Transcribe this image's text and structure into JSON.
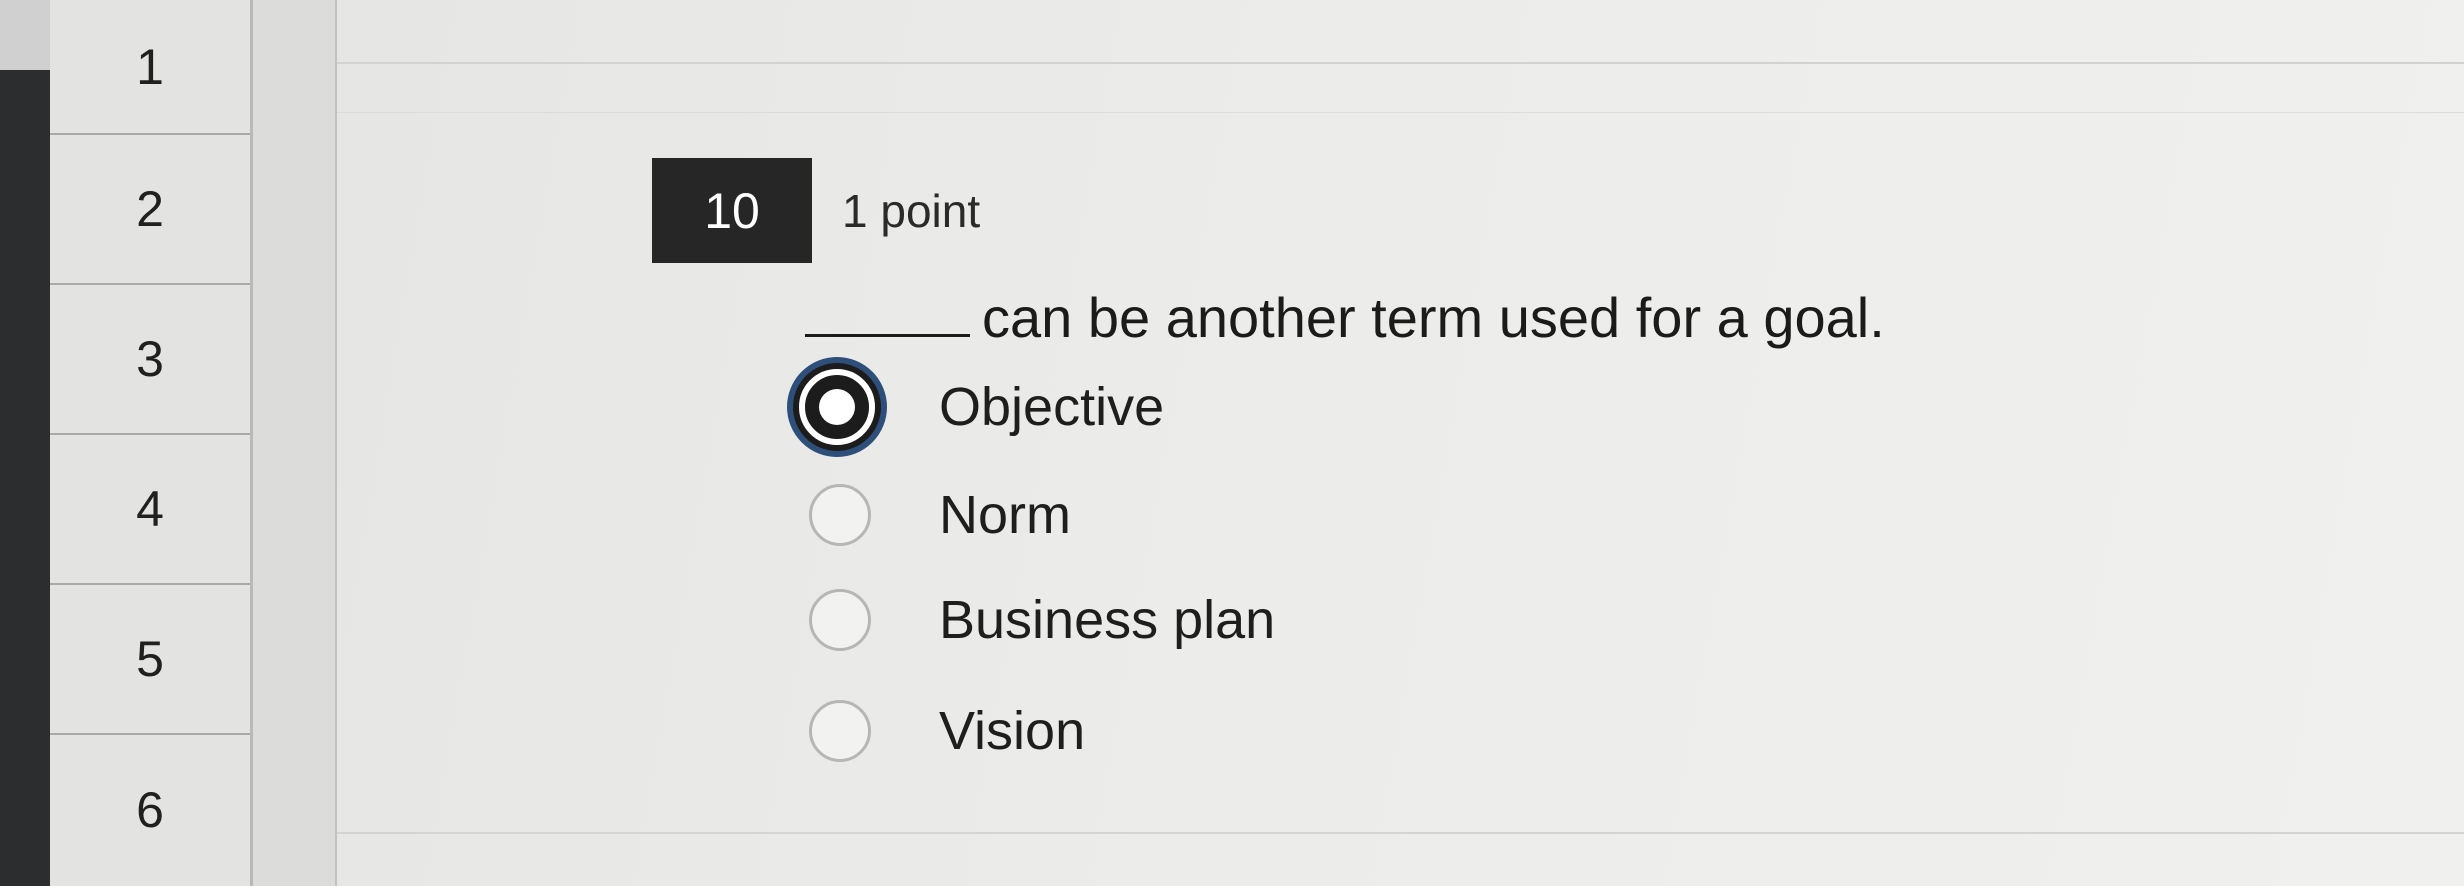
{
  "navigator": {
    "items": [
      "1",
      "2",
      "3",
      "4",
      "5",
      "6"
    ]
  },
  "question": {
    "number": "10",
    "points": "1 point",
    "prompt": "can be another term used for a goal.",
    "options": [
      {
        "label": "Objective",
        "selected": true
      },
      {
        "label": "Norm",
        "selected": false
      },
      {
        "label": "Business plan",
        "selected": false
      },
      {
        "label": "Vision",
        "selected": false
      }
    ]
  },
  "colors": {
    "selected_ring": "#2d4f7a",
    "question_badge": "#262626"
  }
}
